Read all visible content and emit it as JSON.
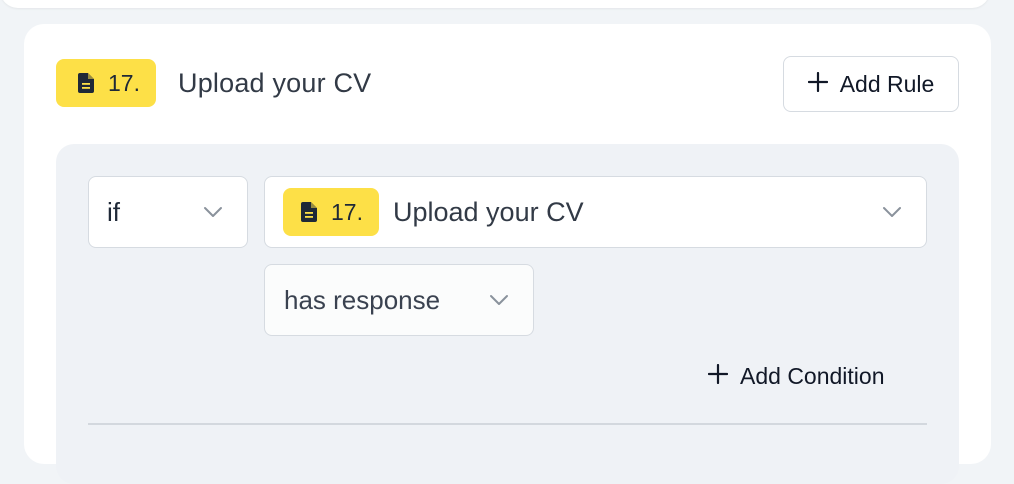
{
  "question": {
    "number": "17.",
    "title": "Upload your CV",
    "icon": "document-icon"
  },
  "toolbar": {
    "add_rule_label": "Add Rule"
  },
  "rule": {
    "operator": "if",
    "question_number": "17.",
    "question_title": "Upload your CV",
    "condition": "has response",
    "add_condition_label": "Add Condition"
  },
  "colors": {
    "badge": "#fde047",
    "card": "#ffffff",
    "panel": "#eff2f6",
    "border": "#d6dbe1"
  }
}
